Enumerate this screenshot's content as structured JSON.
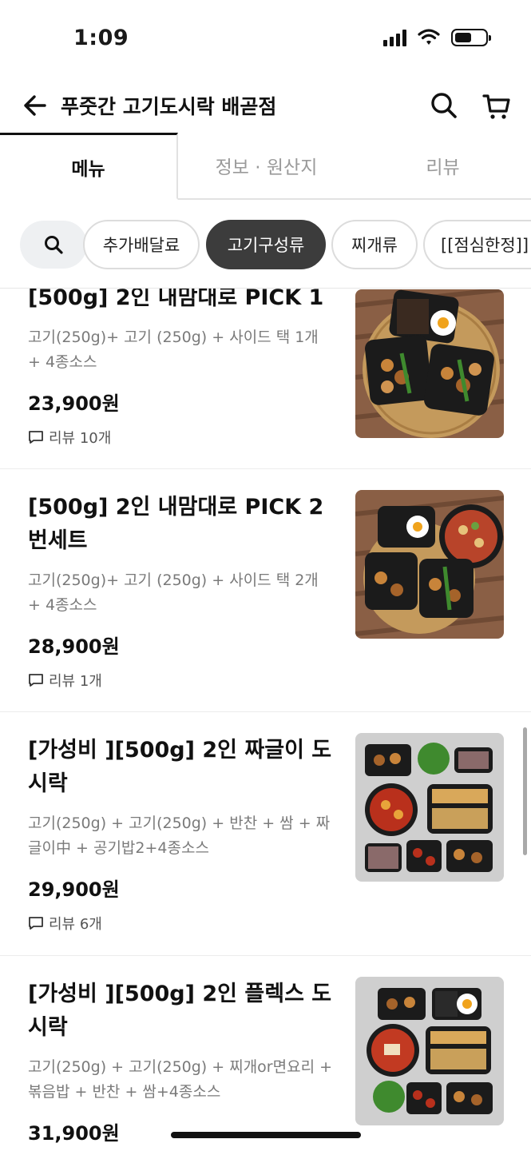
{
  "status_bar": {
    "time": "1:09",
    "battery_level": 0.55
  },
  "header": {
    "back_icon": "arrow-left-icon",
    "title": "푸줏간 고기도시락 배곧점",
    "search_icon": "search-icon",
    "cart_icon": "cart-icon"
  },
  "tabs": [
    {
      "label": "메뉴",
      "active": true
    },
    {
      "label": "정보 · 원산지",
      "active": false
    },
    {
      "label": "리뷰",
      "active": false
    }
  ],
  "category_chips": {
    "search_icon": "search-icon",
    "items": [
      {
        "label": "추가배달료",
        "selected": false
      },
      {
        "label": "고기구성류",
        "selected": true
      },
      {
        "label": "찌개류",
        "selected": false
      },
      {
        "label": "[[점심한정]]",
        "selected": false
      }
    ]
  },
  "menu_items": [
    {
      "name": "[500g] 2인 내맘대로 PICK 1",
      "description": "고기(250g)+ 고기 (250g) + 사이드 택 1개 + 4종소스",
      "price": "23,900원",
      "review": "리뷰 10개",
      "photo": "2 meat boxes + rice box"
    },
    {
      "name": "[500g] 2인 내맘대로 PICK 2번세트",
      "description": "고기(250g)+ 고기 (250g) + 사이드 택 2개 + 4종소스",
      "price": "28,900원",
      "review": "리뷰 1개",
      "photo": "2 meat boxes + noodle bowl"
    },
    {
      "name": "[가성비 ][500g] 2인 짜글이 도시락",
      "description": "고기(250g) + 고기(250g) + 반찬 + 쌈 + 짜글이中 + 공기밥2+4종소스",
      "price": "29,900원",
      "review": "리뷰 6개",
      "photo": "jjageuri set"
    },
    {
      "name": "[가성비 ][500g] 2인 플렉스 도시락",
      "description": "고기(250g) + 고기(250g) + 찌개or면요리 + 볶음밥 + 반찬 + 쌈+4종소스",
      "price": "31,900원",
      "review": "",
      "photo": "flex set"
    }
  ],
  "colors": {
    "text": "#111111",
    "muted": "#7a7a7a",
    "chip_selected": "#3c3c3c",
    "divider": "#ececec"
  }
}
